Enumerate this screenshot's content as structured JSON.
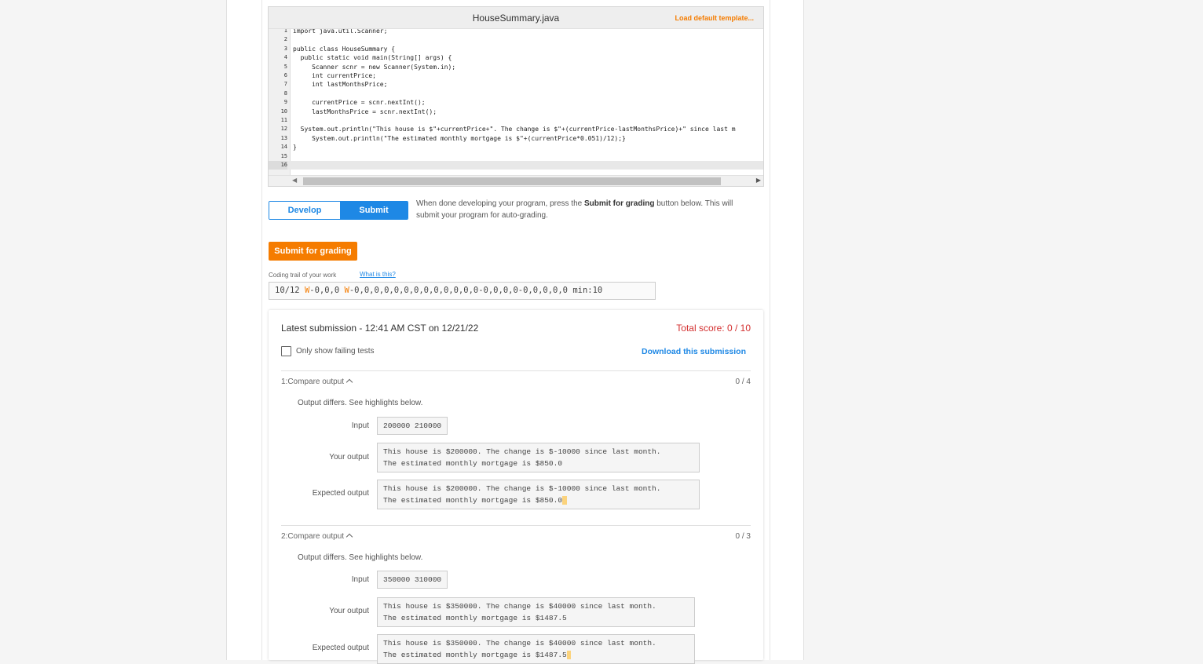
{
  "editor": {
    "file_name": "HouseSummary.java",
    "load_template": "Load default template...",
    "lines": [
      {
        "n": "1",
        "code": "import java.util.Scanner;"
      },
      {
        "n": "2",
        "code": ""
      },
      {
        "n": "3",
        "code": "public class HouseSummary {"
      },
      {
        "n": "4",
        "code": "  public static void main(String[] args) {"
      },
      {
        "n": "5",
        "code": "     Scanner scnr = new Scanner(System.in);"
      },
      {
        "n": "6",
        "code": "     int currentPrice;"
      },
      {
        "n": "7",
        "code": "     int lastMonthsPrice;"
      },
      {
        "n": "8",
        "code": ""
      },
      {
        "n": "9",
        "code": "     currentPrice = scnr.nextInt();"
      },
      {
        "n": "10",
        "code": "     lastMonthsPrice = scnr.nextInt();"
      },
      {
        "n": "11",
        "code": ""
      },
      {
        "n": "12",
        "code": "  System.out.println(\"This house is $\"+currentPrice+\". The change is $\"+(currentPrice-lastMonthsPrice)+\" since last m"
      },
      {
        "n": "13",
        "code": "     System.out.println(\"The estimated monthly mortgage is $\"+(currentPrice*0.051)/12);}"
      },
      {
        "n": "14",
        "code": "}"
      },
      {
        "n": "15",
        "code": ""
      },
      {
        "n": "16",
        "code": ""
      }
    ]
  },
  "modes": {
    "develop": "Develop mode",
    "submit": "Submit mode",
    "desc_before": "When done developing your program, press the ",
    "desc_bold": "Submit for grading",
    "desc_after": " button below. This will submit your program for auto-grading."
  },
  "submit_button": "Submit for grading",
  "trail": {
    "label": "Coding trail of your work",
    "link": "What is this?",
    "prefix": "10/12 ",
    "w1": "W",
    "mid": "-0,0,0 ",
    "w2": "W",
    "rest": "-0,0,0,0,0,0,0,0,0,0,0,0,0-0,0,0,0-0,0,0,0,0 min:10"
  },
  "results": {
    "latest": "Latest submission - 12:41 AM CST on 12/21/22",
    "total": "Total score: 0 / 10",
    "only_failing": "Only show failing tests",
    "download": "Download this submission",
    "tests": [
      {
        "title": "1:Compare output",
        "score": "0 / 4",
        "diff": "Output differs. See highlights below.",
        "input_label": "Input",
        "input": "200000 210000",
        "your_label": "Your output",
        "your_line1": "This house is $200000. The change is $-10000 since last month.",
        "your_line2": "The estimated monthly mortgage is $850.0",
        "expected_label": "Expected output",
        "exp_line1": "This house is $200000. The change is $-10000 since last month.",
        "exp_line2": "The estimated monthly mortgage is $850.0"
      },
      {
        "title": "2:Compare output",
        "score": "0 / 3",
        "diff": "Output differs. See highlights below.",
        "input_label": "Input",
        "input": "350000 310000",
        "your_label": "Your output",
        "your_line1": "This house is $350000. The change is $40000 since last month.",
        "your_line2": "The estimated monthly mortgage is $1487.5",
        "expected_label": "Expected output",
        "exp_line1": "This house is $350000. The change is $40000 since last month.",
        "exp_line2": "The estimated monthly mortgage is $1487.5"
      }
    ]
  },
  "colors": {
    "accent_blue": "#1e88e5",
    "accent_orange": "#f57c00",
    "score_red": "#d32f2f",
    "highlight": "#fbd37d"
  }
}
